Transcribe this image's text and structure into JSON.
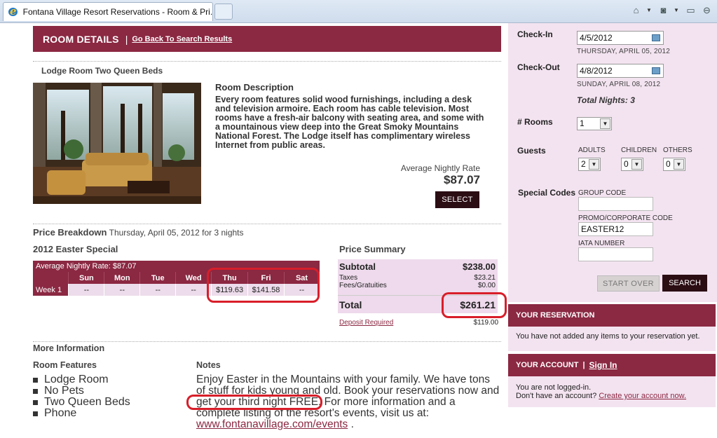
{
  "browser": {
    "tab_title": "Fontana Village Resort Reservations - Room & Pri...",
    "icons": [
      "home-icon",
      "feeds-icon",
      "page-icon",
      "tools-icon"
    ]
  },
  "header": {
    "title": "ROOM DETAILS",
    "separator": "|",
    "back_link": "Go Back To Search Results"
  },
  "room": {
    "name": "Lodge Room Two Queen Beds",
    "desc_title": "Room Description",
    "description": "Every room features solid wood furnishings, including a desk and television armoire. Each room has cable television. Most rooms have a fresh-air balcony with seating area, and some with a mountainous view deep into the Great Smoky Mountains National Forest. The Lodge itself has complimentary wireless Internet from public areas.",
    "avg_label": "Average Nightly Rate",
    "avg_price": "$87.07",
    "select_label": "SELECT"
  },
  "price_breakdown": {
    "title": "Price Breakdown",
    "subtitle": "Thursday, April 05, 2012 for 3 nights",
    "special_title": "2012 Easter Special",
    "avg_rate_row": "Average Nightly Rate: $87.07",
    "days": [
      "Sun",
      "Mon",
      "Tue",
      "Wed",
      "Thu",
      "Fri",
      "Sat"
    ],
    "week_label": "Week 1",
    "week_values": [
      "--",
      "--",
      "--",
      "--",
      "$119.63",
      "$141.58",
      "--"
    ]
  },
  "price_summary": {
    "title": "Price Summary",
    "subtotal_label": "Subtotal",
    "subtotal": "$238.00",
    "taxes_label": "Taxes",
    "taxes": "$23.21",
    "fees_label": "Fees/Gratuities",
    "fees": "$0.00",
    "total_label": "Total",
    "total": "$261.21",
    "deposit_label": "Deposit Required",
    "deposit": "$119.00"
  },
  "more_info": {
    "title": "More Information",
    "features_title": "Room Features",
    "features": [
      "Lodge Room",
      "No Pets",
      "Two Queen Beds",
      "Phone"
    ],
    "notes_title": "Notes",
    "notes_text": "Enjoy Easter in the Mountains with your family. We have tons of stuff for kids young and old. Book your reservations now and get your third night FREE. For more information and a complete listing of the resort's events, visit us at:",
    "notes_link": "www.fontanavillage.com/events",
    "notes_end": "."
  },
  "booking": {
    "checkin_label": "Check-In",
    "checkin_value": "4/5/2012",
    "checkin_day": "THURSDAY, APRIL 05, 2012",
    "checkout_label": "Check-Out",
    "checkout_value": "4/8/2012",
    "checkout_day": "SUNDAY, APRIL 08, 2012",
    "total_nights": "Total Nights: 3",
    "rooms_label": "# Rooms",
    "rooms_value": "1",
    "guests_label": "Guests",
    "adults_label": "ADULTS",
    "adults_value": "2",
    "children_label": "CHILDREN",
    "children_value": "0",
    "others_label": "OTHERS",
    "others_value": "0",
    "codes_label": "Special Codes",
    "group_label": "GROUP CODE",
    "group_value": "",
    "promo_label": "PROMO/CORPORATE CODE",
    "promo_value": "EASTER12",
    "iata_label": "IATA NUMBER",
    "iata_value": "",
    "start_over_label": "START OVER",
    "search_label": "SEARCH"
  },
  "reservation": {
    "title": "YOUR RESERVATION",
    "message": "You have not added any items to your reservation yet."
  },
  "account": {
    "title": "YOUR ACCOUNT",
    "separator": "|",
    "sign_in": "Sign In",
    "line1": "You are not logged-in.",
    "line2": "Don't have an account?",
    "create_link": "Create your account now."
  },
  "colors": {
    "brand": "#8b2842",
    "panel_bg": "#f3e3f0",
    "button_dark": "#2b0d14",
    "annotation": "#d81e2a"
  }
}
